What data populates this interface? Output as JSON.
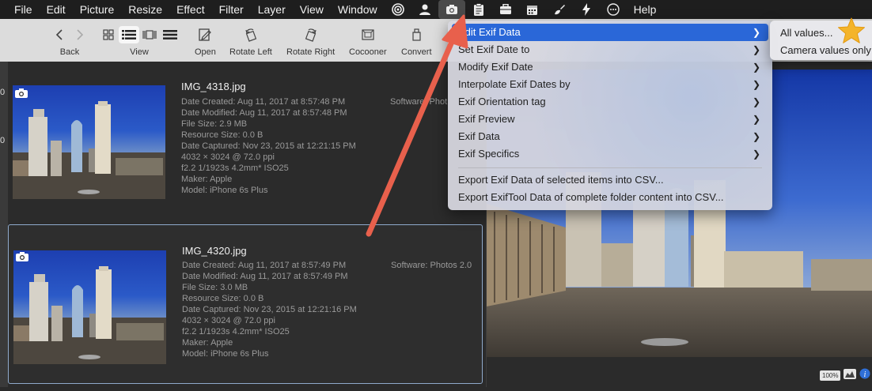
{
  "menubar": {
    "items": [
      "File",
      "Edit",
      "Picture",
      "Resize",
      "Effect",
      "Filter",
      "Layer",
      "View",
      "Window"
    ],
    "help": "Help",
    "icons": [
      "target-icon",
      "person-icon",
      "camera-icon",
      "clipboard-icon",
      "briefcase-icon",
      "calendar-icon",
      "brush-icon",
      "lightning-icon",
      "ellipsis-icon"
    ],
    "active_icon": "camera-icon"
  },
  "toolbar": {
    "back": "Back",
    "view": "View",
    "open": "Open",
    "rotate_left": "Rotate Left",
    "rotate_right": "Rotate Right",
    "cocooner": "Cocooner",
    "convert": "Convert"
  },
  "left_edge": [
    "0",
    "0"
  ],
  "files": [
    {
      "name": "IMG_4318.jpg",
      "meta": [
        "Date Created: Aug 11, 2017 at 8:57:48 PM",
        "Date Modified: Aug 11, 2017 at 8:57:48 PM",
        "File Size: 2.9 MB",
        "Resource Size: 0.0 B",
        "Date Captured: Nov 23, 2015 at 12:21:15 PM",
        "4032 × 3024 @ 72.0 ppi",
        "f2.2 1/1923s 4.2mm* ISO25",
        "Maker: Apple",
        "Model: iPhone 6s Plus"
      ],
      "software": "Software: Phot",
      "selected": false
    },
    {
      "name": "IMG_4320.jpg",
      "meta": [
        "Date Created: Aug 11, 2017 at 8:57:49 PM",
        "Date Modified: Aug 11, 2017 at 8:57:49 PM",
        "File Size: 3.0 MB",
        "Resource Size: 0.0 B",
        "Date Captured: Nov 23, 2015 at 12:21:16 PM",
        "4032 × 3024 @ 72.0 ppi",
        "f2.2 1/1923s 4.2mm* ISO25",
        "Maker: Apple",
        "Model: iPhone 6s Plus"
      ],
      "software": "Software: Photos 2.0",
      "selected": true
    }
  ],
  "menu": {
    "items": [
      {
        "label": "Edit Exif Data",
        "submenu": true,
        "highlighted": true
      },
      {
        "label": "Set Exif Date to",
        "submenu": true
      },
      {
        "label": "Modify Exif Date",
        "submenu": true
      },
      {
        "label": "Interpolate Exif Dates by",
        "submenu": true
      },
      {
        "label": "Exif Orientation tag",
        "submenu": true
      },
      {
        "label": "Exif Preview",
        "submenu": true
      },
      {
        "label": "Exif Data",
        "submenu": true
      },
      {
        "label": "Exif Specifics",
        "submenu": true
      }
    ],
    "actions": [
      "Export Exif Data of selected items into CSV...",
      "Export ExifTool Data of complete folder content into CSV..."
    ]
  },
  "submenu": {
    "items": [
      "All values...",
      "Camera values only"
    ]
  },
  "bottom_bar": {
    "zoom": "100%"
  },
  "colors": {
    "highlight": "#2a67d8",
    "annotation_arrow": "#e8604c",
    "selection_border": "#8faacc",
    "star": "#f4b42a"
  }
}
